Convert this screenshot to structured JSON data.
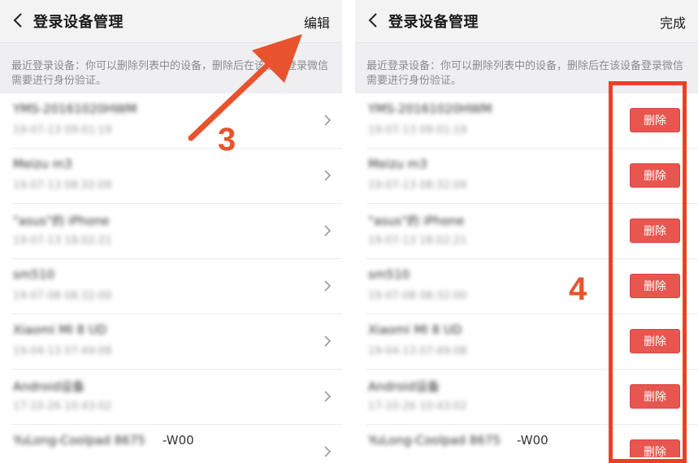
{
  "left_screen": {
    "nav": {
      "title": "登录设备管理",
      "action": "编辑"
    },
    "hint": "最近登录设备：你可以删除列表中的设备，删除后在该设备登录微信需要进行身份验证。",
    "devices": [
      {
        "name": "YMS-20161020HWM",
        "time": "19-07-13 09:01:19"
      },
      {
        "name": "Meizu m3",
        "time": "19-07-13 08:32:09"
      },
      {
        "name": "\"asus\"的 iPhone",
        "time": "19-07-13 18:02:21"
      },
      {
        "name": "sm510",
        "time": "19-07-08 08:32:00"
      },
      {
        "name": "Xiaomi MI 8 UD",
        "time": "19-04-13 07:49:08"
      },
      {
        "name": "Android设备",
        "time": "17-10-26 10:43:02"
      },
      {
        "name": "YuLong-Coolpad 8675",
        "suffix": "-W00",
        "time": ""
      }
    ],
    "annotation": "3"
  },
  "right_screen": {
    "nav": {
      "title": "登录设备管理",
      "action": "完成"
    },
    "hint": "最近登录设备：你可以删除列表中的设备，删除后在该设备登录微信需要进行身份验证。",
    "delete_label": "删除",
    "devices": [
      {
        "name": "YMS-20161020HWM",
        "time": "19-07-13 09:01:19"
      },
      {
        "name": "Meizu m3",
        "time": "19-07-13 08:32:09"
      },
      {
        "name": "\"asus\"的 iPhone",
        "time": "19-07-13 18:02:21"
      },
      {
        "name": "sm510",
        "time": "19-07-08 08:32:00"
      },
      {
        "name": "Xiaomi MI 8 UD",
        "time": "19-04-13 07:49:08"
      },
      {
        "name": "Android设备",
        "time": "17-10-26 10:43:02"
      },
      {
        "name": "YuLong-Coolpad 8675",
        "suffix": "-W00",
        "time": ""
      }
    ],
    "annotation": "4"
  },
  "colors": {
    "annotation": "#e8532d",
    "delete_button": "#e85650",
    "highlight_box": "#e94125"
  }
}
